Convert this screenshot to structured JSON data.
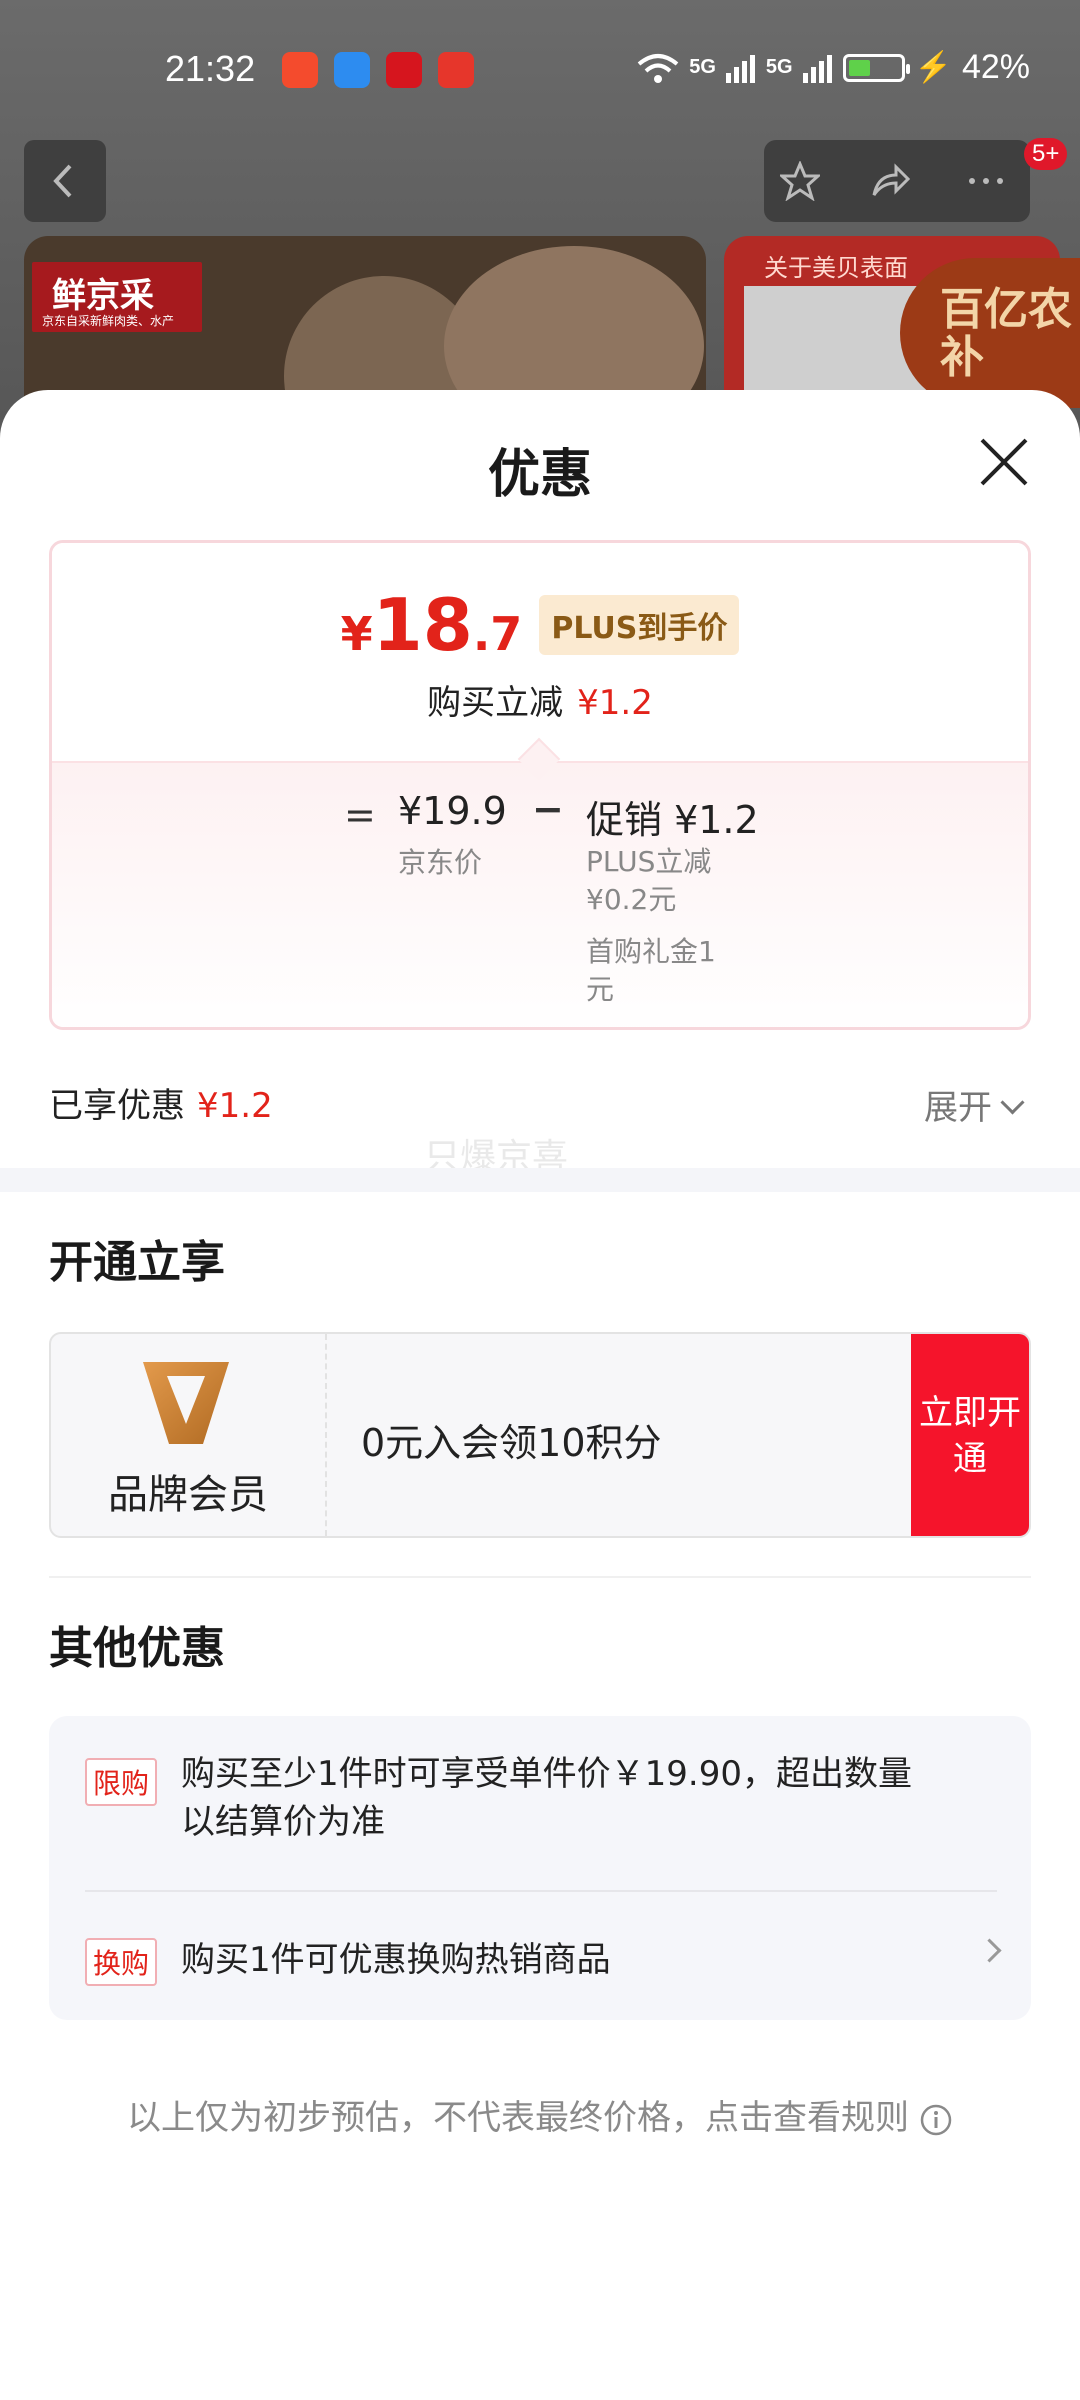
{
  "status_bar": {
    "time": "21:32",
    "network1": "5G",
    "network2": "5G",
    "battery_percent": "42%",
    "battery_level": 0.42,
    "app_icons": [
      "app-icon-orange",
      "search-app-icon",
      "heart-app-icon",
      "taobao-app-icon"
    ]
  },
  "background": {
    "notification_badge": "5+",
    "hero_left_brand": "鲜京采",
    "hero_left_tagline": "京东自采新鲜肉类、水产",
    "hero_right_title": "关于美贝表面",
    "corner_badge": "百亿农补"
  },
  "sheet": {
    "title": "优惠",
    "price": {
      "yen": "¥",
      "integer": "18",
      "decimal": ".7",
      "plus_tag": "PLUS到手价",
      "sub_label": "购买立减",
      "sub_amount": "¥1.2"
    },
    "breakdown": {
      "equals": "=",
      "jd_price": "¥19.9",
      "jd_label": "京东价",
      "minus": "−",
      "promo_line": "促销 ¥1.2",
      "promo_detail1": "PLUS立减¥0.2元",
      "promo_detail2": "首购礼金1元"
    },
    "enjoyed_label": "已享优惠",
    "enjoyed_amount": "¥1.2",
    "expand_label": "展开",
    "watermark": "只爆京喜"
  },
  "open_section": {
    "heading": "开通立享",
    "member_name": "品牌会员",
    "member_desc": "0元入会领10积分",
    "open_button": "立即开通"
  },
  "other_section": {
    "heading": "其他优惠",
    "items": [
      {
        "tag": "限购",
        "text": "购买至少1件时可享受单件价￥19.90，超出数量以结算价为准"
      },
      {
        "tag": "换购",
        "text": "购买1件可优惠换购热销商品"
      }
    ]
  },
  "disclaimer": "以上仅为初步预估，不代表最终价格，点击查看规则",
  "colors": {
    "price_red": "#e2231a",
    "button_red": "#f5142b",
    "plus_gold": "#8a5a16"
  }
}
